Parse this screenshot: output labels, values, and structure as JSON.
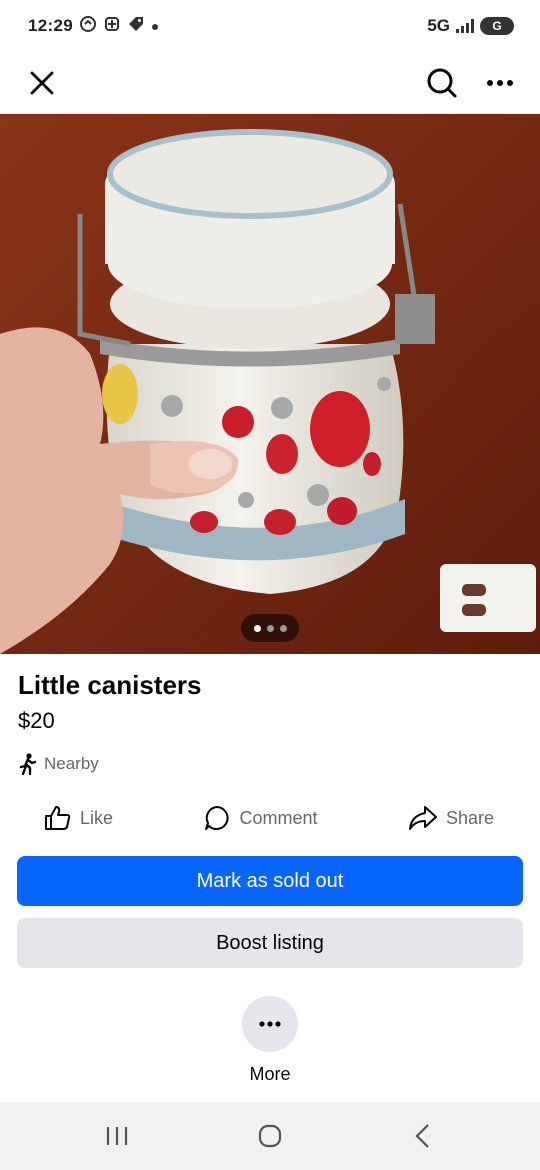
{
  "status_bar": {
    "time": "12:29",
    "network": "5G",
    "battery": "G",
    "left_icons": [
      "notification-icon",
      "nfc-icon",
      "tag-icon",
      "dot-icon"
    ],
    "right_icons": [
      "signal-icon",
      "battery-icon"
    ]
  },
  "header": {
    "close_icon": "close-icon",
    "search_icon": "search-icon",
    "more_icon": "more-horizontal-icon"
  },
  "photo": {
    "description_icon": "product-photo",
    "carousel": {
      "total": 3,
      "active_index": 0
    }
  },
  "listing": {
    "title": "Little canisters",
    "price": "$20",
    "location": "Nearby"
  },
  "actions": {
    "like": "Like",
    "comment": "Comment",
    "share": "Share"
  },
  "buttons": {
    "primary": "Mark as sold out",
    "secondary": "Boost listing",
    "more": "More"
  },
  "colors": {
    "primary": "#0866ff",
    "secondary_bg": "#e4e6eb",
    "muted_text": "#65676b"
  }
}
